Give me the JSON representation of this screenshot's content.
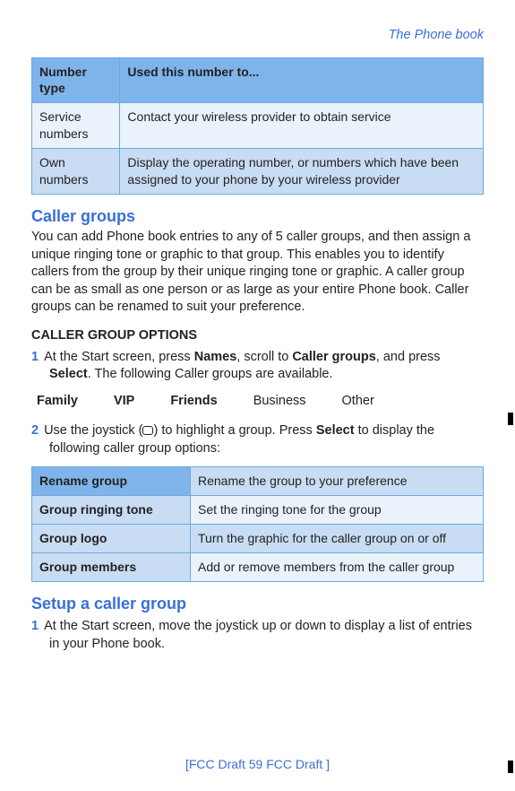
{
  "header": {
    "breadcrumb": "The Phone book"
  },
  "table1": {
    "headers": [
      "Number type",
      "Used this number to..."
    ],
    "rows": [
      [
        "Service numbers",
        "Contact your wireless provider to obtain service"
      ],
      [
        "Own numbers",
        "Display the operating number, or numbers which have been assigned to your phone by your wireless provider"
      ]
    ]
  },
  "section1": {
    "title": "Caller groups",
    "body": "You can add Phone book entries to any of 5 caller groups, and then assign a unique ringing tone or graphic to that group. This enables you to identify callers from the group by their unique ringing tone or graphic. A caller group can be as small as one person or as large as your entire Phone book. Caller groups can be renamed to suit your preference."
  },
  "options": {
    "heading": "CALLER GROUP OPTIONS",
    "step1_num": "1",
    "step1_a": "At the Start screen, press ",
    "step1_b": "Names",
    "step1_c": ", scroll to ",
    "step1_d": "Caller groups",
    "step1_e": ", and press ",
    "step1_f": "Select",
    "step1_g": ". The following Caller groups are available.",
    "groups": [
      "Family",
      "VIP",
      "Friends",
      "Business",
      "Other"
    ],
    "step2_num": "2",
    "step2_a": "Use the joystick (",
    "step2_b": ") to highlight a group. Press ",
    "step2_c": "Select",
    "step2_d": " to display the following caller group options:"
  },
  "table2": {
    "rows": [
      [
        "Rename group",
        "Rename the group to your preference"
      ],
      [
        "Group ringing tone",
        "Set the ringing tone for the group"
      ],
      [
        "Group logo",
        "Turn the graphic for the caller group on or off"
      ],
      [
        "Group members",
        "Add or remove members from the caller group"
      ]
    ]
  },
  "section2": {
    "title": "Setup a caller group",
    "step1_num": "1",
    "step1": "At the Start screen, move the joystick up or down to display a list of entries in your Phone book."
  },
  "footer": {
    "text": "[FCC Draft    59   FCC Draft ]"
  }
}
